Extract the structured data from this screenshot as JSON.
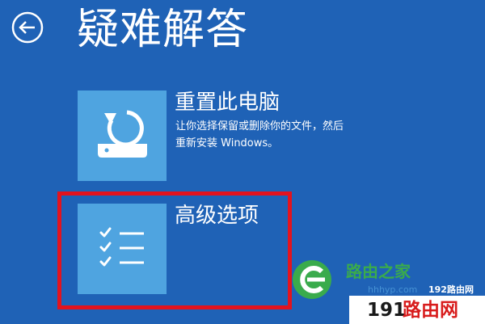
{
  "header": {
    "back_icon": "back-arrow-icon",
    "title": "疑难解答"
  },
  "options": [
    {
      "title": "重置此电脑",
      "icon": "reset-pc-icon",
      "description_lines": [
        "让你选择保留或删除你的文件，然后",
        "重新安装 Windows。"
      ]
    },
    {
      "title": "高级选项",
      "icon": "checklist-icon",
      "description_lines": []
    }
  ],
  "highlight": {
    "color": "#e2131e",
    "target": "高级选项"
  },
  "watermark": {
    "site_name": "路由之家",
    "url_text": "hhhyp.com",
    "small_brand": "192路由网",
    "bottom_number": "191",
    "bottom_chars": "路由网"
  },
  "colors": {
    "background": "#1f62b6",
    "tile": "#4fa4e0",
    "text": "#ffffff",
    "watermark_green": "#3fb83a"
  }
}
